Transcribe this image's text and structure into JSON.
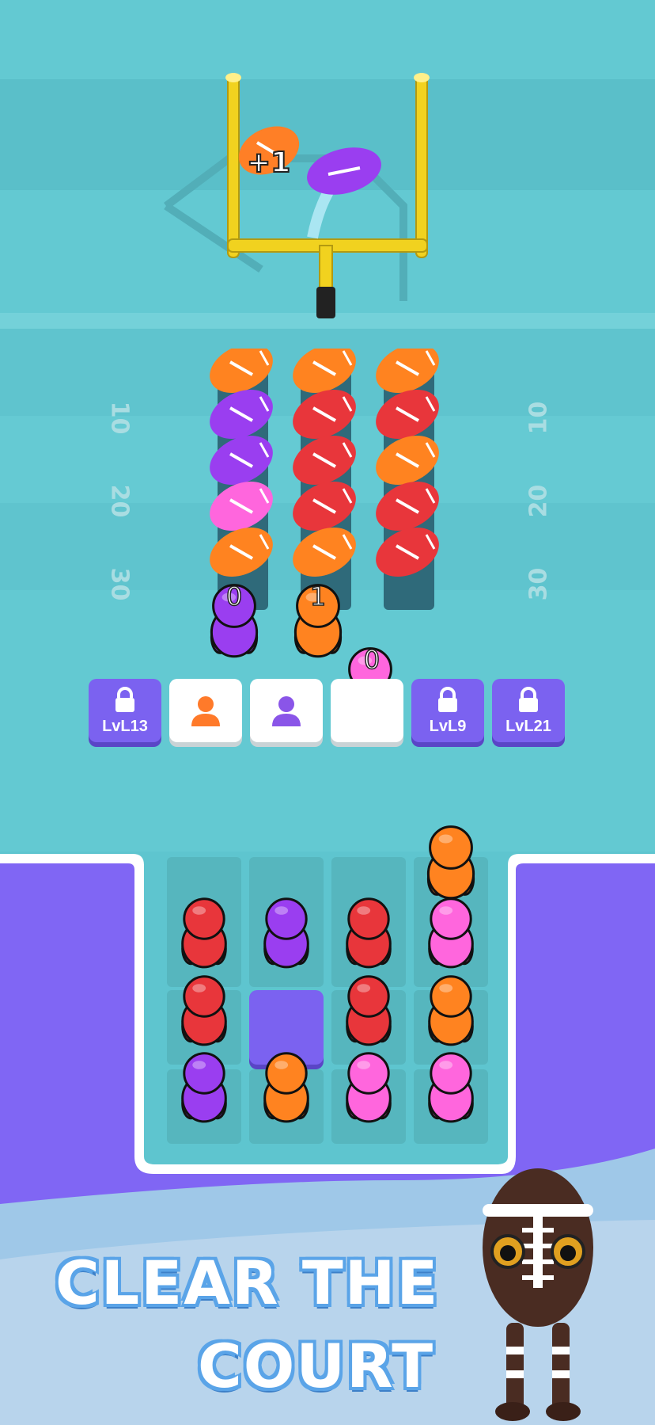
{
  "score_popup": "+1",
  "ball_rack": {
    "columns": [
      {
        "balls": [
          "orange",
          "purple",
          "purple",
          "pink",
          "orange"
        ]
      },
      {
        "balls": [
          "orange",
          "red",
          "red",
          "red",
          "orange"
        ]
      },
      {
        "balls": [
          "orange",
          "red",
          "orange",
          "red",
          "red"
        ]
      }
    ]
  },
  "field_markers": {
    "left": [
      "10",
      "20",
      "30"
    ],
    "right": [
      "10",
      "20",
      "30"
    ]
  },
  "queue_players": [
    {
      "color": "purple",
      "counter": "0"
    },
    {
      "color": "orange",
      "counter": "1"
    },
    {
      "color": "pink",
      "counter": "0"
    }
  ],
  "slots": [
    {
      "state": "locked",
      "label": "LvL13"
    },
    {
      "state": "open",
      "icon": "person-icon",
      "color": "#ff7a2a"
    },
    {
      "state": "open",
      "icon": "person-icon",
      "color": "#8a55e8"
    },
    {
      "state": "open",
      "icon": "",
      "color": ""
    },
    {
      "state": "locked",
      "label": "LvL9"
    },
    {
      "state": "locked",
      "label": "LvL21"
    }
  ],
  "board": {
    "top_waiting": "orange",
    "grid": [
      [
        "red",
        "purple",
        "red",
        "pink"
      ],
      [
        "red",
        "empty",
        "red",
        "orange"
      ],
      [
        "purple",
        "orange",
        "pink",
        "pink"
      ]
    ]
  },
  "promo": {
    "line1": "CLEAR THE",
    "line2": "COURT"
  },
  "colors": {
    "field": "#5ec5cf",
    "purple_zone": "#8066f4",
    "red": "#e8363b",
    "orange": "#ff8320",
    "purple": "#9a3ef0",
    "pink": "#ff66dd",
    "goalpost": "#f1d21f"
  }
}
